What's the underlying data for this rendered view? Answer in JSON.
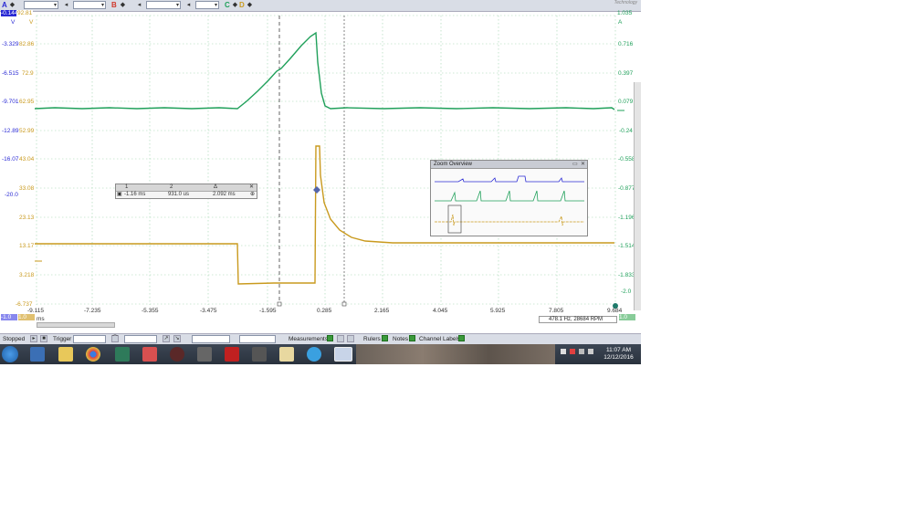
{
  "toolbar": {
    "channel_a": "A",
    "channel_b": "B",
    "channel_c": "C",
    "channel_d": "D",
    "brand": "Technology"
  },
  "y_axes": {
    "blue_unit": "V",
    "orange_unit": "V",
    "green_unit": "A",
    "blue_top": "-0.144",
    "orange_top": "92.81",
    "green_top": "1.035",
    "blue_ticks": [
      "-3.329",
      "-6.515",
      "-9.701",
      "-12.89",
      "-16.07",
      "-20.0"
    ],
    "orange_ticks": [
      "82.86",
      "72.9",
      "62.95",
      "52.99",
      "43.04",
      "33.08",
      "23.13",
      "13.17",
      "3.218",
      "-6.737"
    ],
    "green_ticks": [
      "0.716",
      "0.397",
      "0.079",
      "-0.24",
      "-0.558",
      "-0.877",
      "-1.196",
      "-1.514",
      "-1.833",
      "-2.0"
    ]
  },
  "x_axis": {
    "unit": "ms",
    "ticks": [
      "-9.115",
      "-7.235",
      "-5.355",
      "-3.475",
      "-1.595",
      "0.285",
      "2.165",
      "4.045",
      "5.925",
      "7.805",
      "9.684"
    ]
  },
  "ruler_panel": {
    "col1": "1",
    "col2": "2",
    "col3": "Δ",
    "val1": "-1.16 ms",
    "val2": "931.0 us",
    "delta": "2.092 ms"
  },
  "zoom_overview": {
    "title": "Zoom Overview"
  },
  "freq_readout": "478.1 Hz, 28684 RPM",
  "axis_corner": {
    "blue": "-1.0",
    "orange": "1.0",
    "green": "1.0"
  },
  "statusbar": {
    "state": "Stopped",
    "trigger_label": "Trigger",
    "measurements_label": "Measurements",
    "rulers_label": "Rulers",
    "notes_label": "Notes",
    "channel_labels_label": "Channel Labels"
  },
  "taskbar": {
    "time": "11:07 AM",
    "date": "12/12/2016"
  },
  "colors": {
    "blue": "#2a2ad4",
    "orange": "#c99a1e",
    "green": "#1fa05a"
  }
}
